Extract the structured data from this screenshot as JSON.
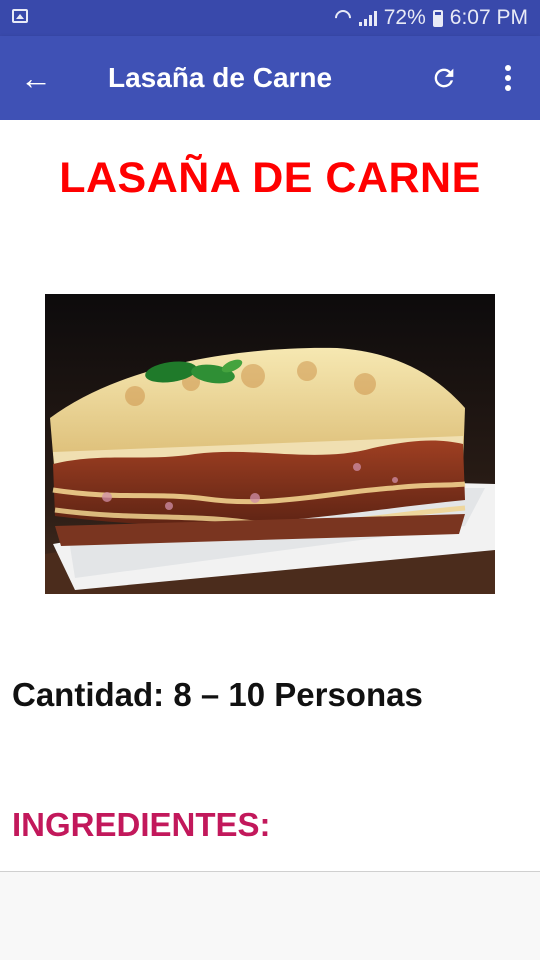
{
  "status_bar": {
    "battery": "72%",
    "time": "6:07 PM",
    "icons": [
      "image-icon",
      "wifi-icon",
      "signal-icon",
      "battery-icon"
    ]
  },
  "app_bar": {
    "title": "Lasaña de Carne",
    "icons": [
      "back-arrow-icon",
      "refresh-icon",
      "more-vert-icon"
    ],
    "color": "#3f51b5"
  },
  "content": {
    "title": "LASAÑA DE CARNE",
    "servings": "Cantidad: 8 – 10 Personas",
    "ingredients_heading": "INGREDIENTES:",
    "colors": {
      "title": "#ff0000",
      "ingredients_heading": "#c2185b"
    }
  }
}
